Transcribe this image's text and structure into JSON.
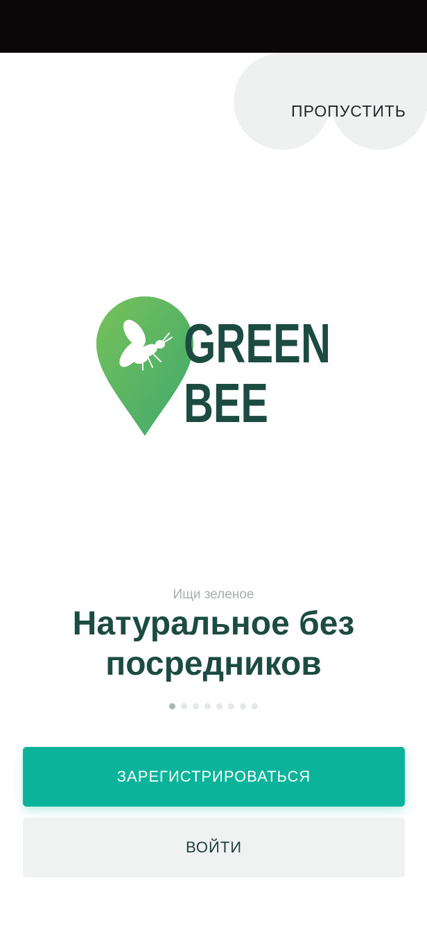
{
  "onboarding": {
    "skip_label": "ПРОПУСТИТЬ",
    "logo_text": [
      "GREEN",
      "BEE"
    ],
    "subtitle": "Ищи зеленое",
    "headline": "Натуральное без посредников",
    "pagination": {
      "total": 8,
      "active": 0
    },
    "register_label": "ЗАРЕГИСТРИРОВАТЬСЯ",
    "login_label": "ВОЙТИ"
  },
  "colors": {
    "brand_dark": "#1c4b42",
    "brand_green": "#6ec05a",
    "primary_button": "#0cb39b",
    "secondary_button": "#f0f2f1",
    "status_bar": "#0b0709"
  },
  "icons": {
    "logo_mark": "map-pin-bee-icon"
  }
}
